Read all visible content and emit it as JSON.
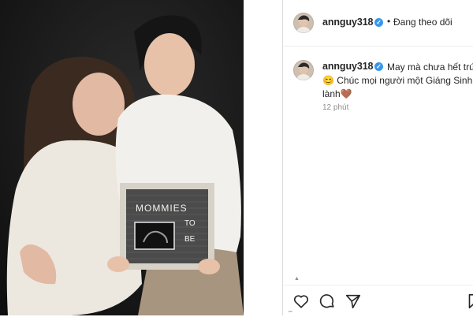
{
  "post": {
    "author": {
      "username": "annguy318",
      "verified_icon": "verified-badge-icon",
      "follow_status": "Đang theo dõi",
      "separator": "•"
    },
    "caption": {
      "line1": "May mà chưa hết trứn",
      "line2": "😊 Chúc mọi người một Giáng Sinh a",
      "line3": "lành🤎"
    },
    "timestamp": "12 phút",
    "photo": {
      "board_text_1": "MOMMIES",
      "board_text_2": "TO",
      "board_text_3": "BE"
    }
  },
  "actions": {
    "like_icon": "heart-icon",
    "comment_icon": "comment-icon",
    "share_icon": "paper-plane-icon",
    "save_icon": "bookmark-icon"
  },
  "colors": {
    "text": "#262626",
    "secondary_text": "#8e8e8e",
    "verified_blue": "#3797f0",
    "divider": "#dbdbdb"
  }
}
